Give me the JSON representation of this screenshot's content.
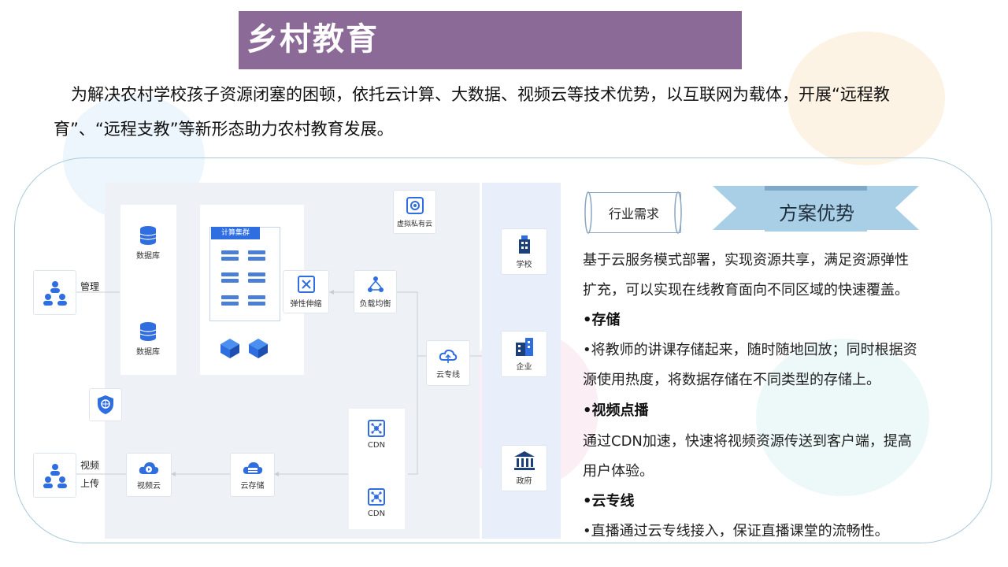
{
  "title": "乡村教育",
  "intro": "为解决农村学校孩子资源闭塞的困顿，依托云计算、大数据、视频云等技术优势，以互联网为载体，开展“远程教育”、“远程支教”等新形态助力农村教育发展。",
  "diagram": {
    "manage_label": "管理",
    "video_label": "视频",
    "upload_label": "上传",
    "db1": "数据库",
    "db2": "数据库",
    "cluster": "计算集群",
    "private_cloud": "虚拟私有云",
    "elastic": "弹性伸缩",
    "load_balance": "负载均衡",
    "cloud_line": "云专线",
    "video_cloud": "视频云",
    "cloud_storage": "云存储",
    "cdn1": "CDN",
    "cdn2": "CDN",
    "school": "学校",
    "enterprise": "企业",
    "government": "政府"
  },
  "tag_label": "行业需求",
  "banner_label": "方案优势",
  "content": {
    "p1_line1": "基于云服务模式部署，实现资源共享，满足资源弹性",
    "p1_line2": "扩充，可以实现在线教育面向不同区域的快速覆盖。",
    "h_storage": "•存储",
    "storage_line1": "•将教师的讲课存储起来，随时随地回放；同时根据资",
    "storage_line2": "源使用热度，将数据存储在不同类型的存储上。",
    "h_vod": "•视频点播",
    "vod_line1": "通过CDN加速，快速将视频资源传送到客户端，提高",
    "vod_line2": "用户体验。",
    "h_line": "•云专线",
    "line_line1": "•直播通过云专线接入，保证直播课堂的流畅性。"
  },
  "colors": {
    "title_bg": "#8c6a98",
    "accent_blue": "#2f6ee0",
    "banner_blue": "#a9cfe6",
    "frame": "#a9c9da"
  },
  "icons": [
    "users-icon",
    "database-icon",
    "server-icon",
    "cube-icon",
    "private-cloud-icon",
    "elastic-scaling-icon",
    "load-balance-icon",
    "cloud-line-icon",
    "shield-icon",
    "video-cloud-icon",
    "cloud-storage-icon",
    "cdn-icon",
    "school-icon",
    "enterprise-icon",
    "government-icon"
  ]
}
